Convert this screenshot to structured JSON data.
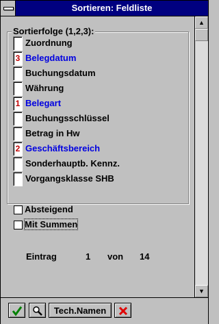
{
  "window": {
    "title": "Sortieren: Feldliste"
  },
  "group": {
    "title": "Sortierfolge (1,2,3):"
  },
  "fields": [
    {
      "prio": "",
      "label": "Zuordnung",
      "selected": false
    },
    {
      "prio": "3",
      "label": "Belegdatum",
      "selected": true
    },
    {
      "prio": "",
      "label": "Buchungsdatum",
      "selected": false
    },
    {
      "prio": "",
      "label": "Währung",
      "selected": false
    },
    {
      "prio": "1",
      "label": "Belegart",
      "selected": true
    },
    {
      "prio": "",
      "label": "Buchungsschlüssel",
      "selected": false
    },
    {
      "prio": "",
      "label": "Betrag in Hw",
      "selected": false
    },
    {
      "prio": "2",
      "label": "Geschäftsbereich",
      "selected": true
    },
    {
      "prio": "",
      "label": "Sonderhauptb. Kennz.",
      "selected": false
    },
    {
      "prio": "",
      "label": "Vorgangsklasse SHB",
      "selected": false
    }
  ],
  "options": {
    "descending_label": "Absteigend",
    "descending_checked": false,
    "totals_label": "Mit Summen",
    "totals_checked": false
  },
  "entry": {
    "label": "Eintrag",
    "current": "1",
    "of_label": "von",
    "total": "14"
  },
  "toolbar": {
    "tech_names_label": "Tech.Namen",
    "colors": {
      "ok": "#008000",
      "cancel": "#e00000"
    }
  }
}
